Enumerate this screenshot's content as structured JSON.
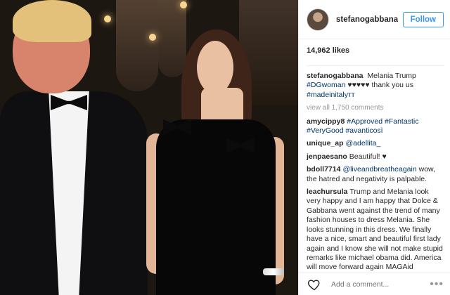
{
  "post": {
    "username": "stefanogabbana",
    "follow_label": "Follow",
    "likes": "14,962 likes",
    "view_all": "view all 1,750 comments",
    "add_comment_placeholder": "Add a comment...",
    "more_label": "•••"
  },
  "colors": {
    "accent": "#3897f0",
    "link": "#003569",
    "muted": "#999999"
  },
  "caption": {
    "username": "stefanogabbana",
    "text1": "Melania Trump",
    "tag1": "#DGwoman",
    "text2": "♥♥♥♥♥ thank you us",
    "tag2": "#madeinitalyᴛᴛ"
  },
  "comments": [
    {
      "username": "amycippy8",
      "parts": [
        {
          "t": "tag",
          "v": "#Approved"
        },
        {
          "t": "txt",
          "v": " "
        },
        {
          "t": "tag",
          "v": "#Fantastic"
        },
        {
          "t": "txt",
          "v": " "
        },
        {
          "t": "tag",
          "v": "#VeryGood"
        },
        {
          "t": "txt",
          "v": " "
        },
        {
          "t": "tag",
          "v": "#avanticosì"
        }
      ]
    },
    {
      "username": "unique_ap",
      "parts": [
        {
          "t": "tag",
          "v": "@adellita_"
        }
      ]
    },
    {
      "username": "jenpaesano",
      "parts": [
        {
          "t": "txt",
          "v": "Beautiful! ♥"
        }
      ]
    },
    {
      "username": "bdoll7714",
      "parts": [
        {
          "t": "tag",
          "v": "@liveandbreatheagain"
        },
        {
          "t": "txt",
          "v": " wow, the hatred and negativity is palpable."
        }
      ]
    },
    {
      "username": "leachursula",
      "parts": [
        {
          "t": "txt",
          "v": "Trump and Melania look very happy and I am happy that Dolce & Gabbana went against the trend of many fashion houses to dress Melania. She looks stunning in this dress. We finally have a nice, smart and beautiful first lady again and I know she will not make stupid remarks like michael obama did. America will move forward again MAGAid"
        }
      ]
    }
  ],
  "icons": {
    "avatar": "avatar",
    "like": "heart-icon",
    "more": "more-icon"
  }
}
